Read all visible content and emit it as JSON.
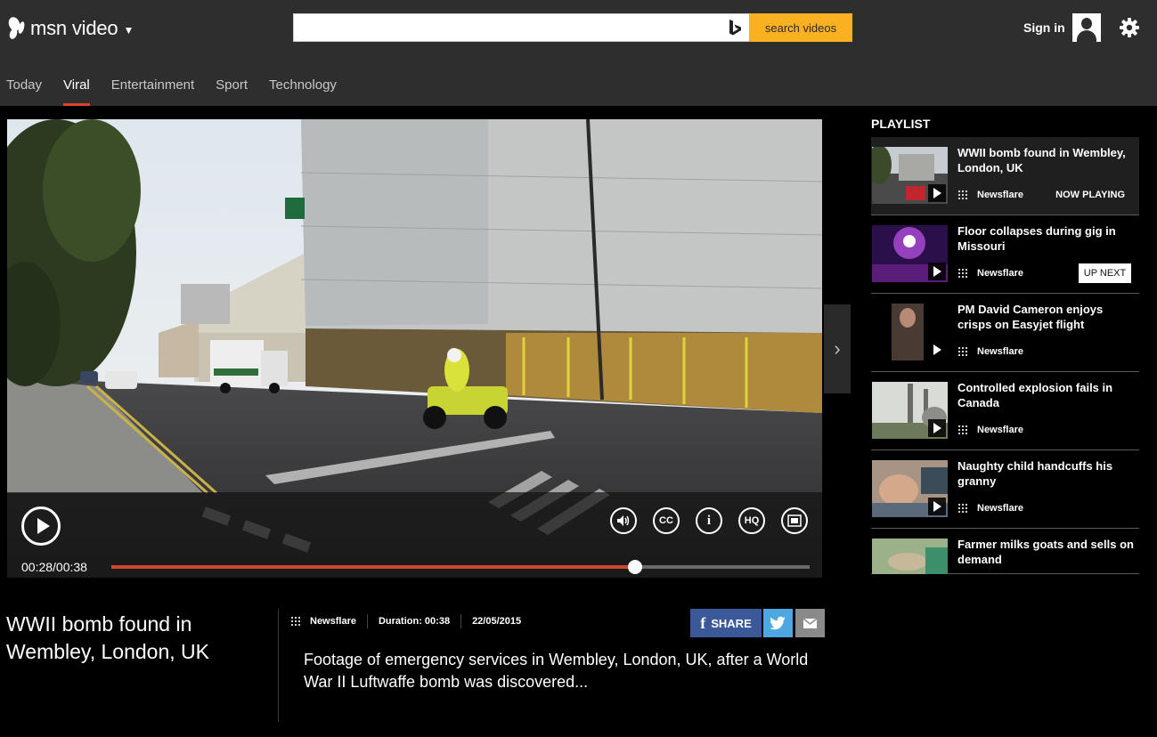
{
  "header": {
    "brand": "msn video",
    "search_placeholder": "",
    "search_button": "search videos",
    "signin": "Sign in"
  },
  "nav": {
    "tabs": [
      {
        "label": "Today",
        "active": false
      },
      {
        "label": "Viral",
        "active": true
      },
      {
        "label": "Entertainment",
        "active": false
      },
      {
        "label": "Sport",
        "active": false
      },
      {
        "label": "Technology",
        "active": false
      }
    ]
  },
  "player": {
    "time": "00:28/00:38",
    "progress": 0.75,
    "controls": [
      "volume-icon",
      "cc-icon",
      "info-icon",
      "hq-icon",
      "fullscreen-icon"
    ],
    "cc_label": "CC",
    "info_label": "i",
    "hq_label": "HQ"
  },
  "playlist": {
    "title": "PLAYLIST",
    "items": [
      {
        "title": "WWII bomb found in Wembley, London, UK",
        "source": "Newsflare",
        "badge": "NOW PLAYING"
      },
      {
        "title": "Floor collapses during gig in Missouri",
        "source": "Newsflare",
        "badge": "UP NEXT"
      },
      {
        "title": "PM David Cameron enjoys crisps on Easyjet flight",
        "source": "Newsflare",
        "badge": ""
      },
      {
        "title": "Controlled explosion fails in Canada",
        "source": "Newsflare",
        "badge": ""
      },
      {
        "title": "Naughty child handcuffs his granny",
        "source": "Newsflare",
        "badge": ""
      },
      {
        "title": "Farmer milks goats and sells on demand",
        "source": "",
        "badge": ""
      }
    ]
  },
  "video": {
    "title": "WWII bomb found in Wembley, London, UK",
    "source": "Newsflare",
    "duration": "Duration: 00:38",
    "date": "22/05/2015",
    "description": "Footage of emergency services in Wembley, London, UK, after a World War II Luftwaffe bomb was discovered...",
    "share_label": "SHARE",
    "share_f": "f"
  },
  "colors": {
    "accent": "#e0412c",
    "search_button": "#f9b121",
    "facebook": "#3b5998",
    "twitter": "#4ea7e0",
    "mail": "#8a8a8a"
  }
}
